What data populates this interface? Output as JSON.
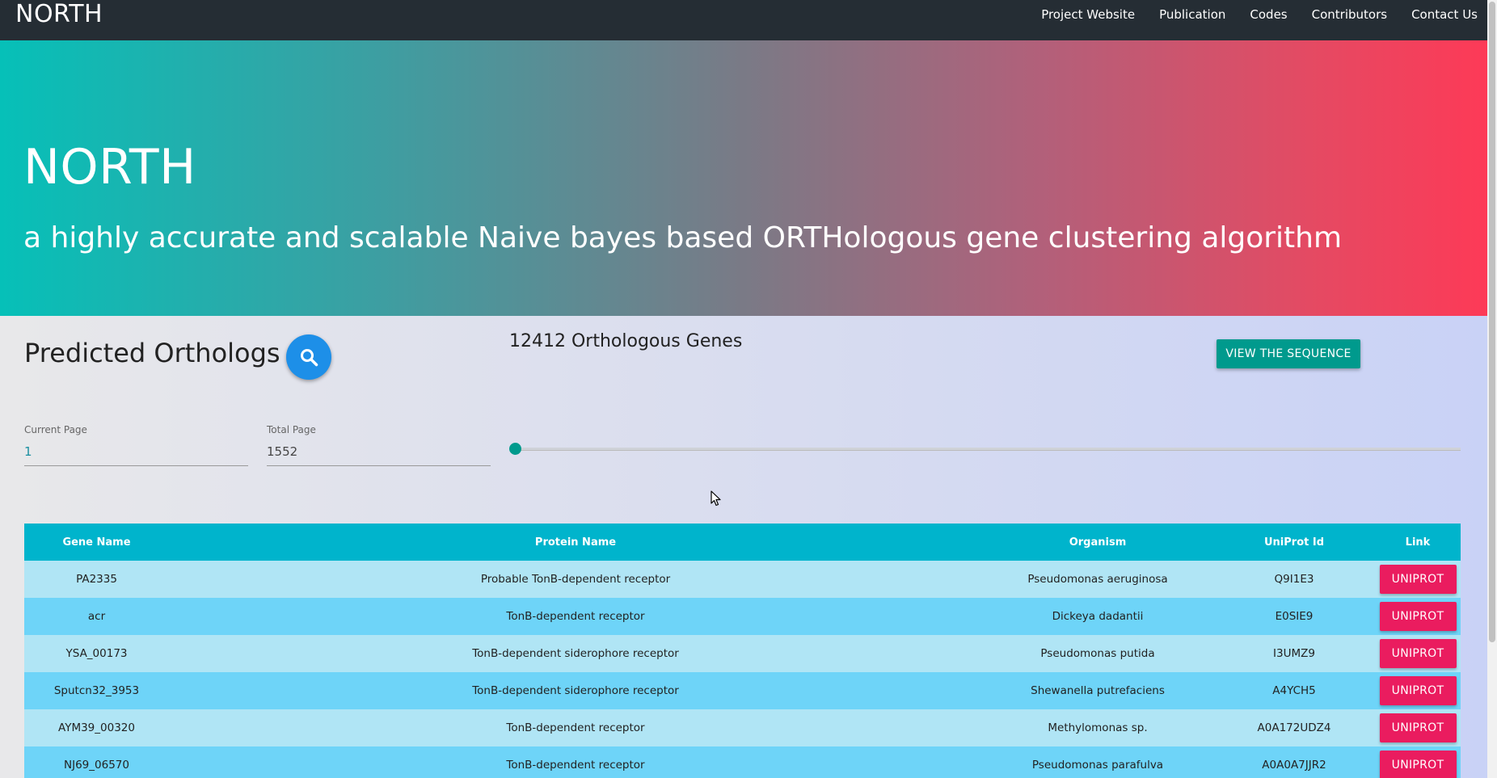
{
  "navbar": {
    "brand": "NORTH",
    "links": [
      "Project Website",
      "Publication",
      "Codes",
      "Contributors",
      "Contact Us"
    ]
  },
  "hero": {
    "title": "NORTH",
    "subtitle": "a highly accurate and scalable Naive bayes based ORTHologous gene clustering algorithm"
  },
  "section": {
    "title": "Predicted Orthologs",
    "gene_count": "12412 Orthologous Genes",
    "view_button": "VIEW THE SEQUENCE",
    "current_page_label": "Current Page",
    "current_page_value": "1",
    "total_page_label": "Total Page",
    "total_page_value": "1552",
    "slider_value": 1
  },
  "table": {
    "headers": [
      "Gene Name",
      "Protein Name",
      "Organism",
      "UniProt Id",
      "Link"
    ],
    "rows": [
      {
        "gene": "PA2335",
        "protein": "Probable TonB-dependent receptor",
        "organism": "Pseudomonas aeruginosa",
        "uniprot": "Q9I1E3",
        "link": "UNIPROT"
      },
      {
        "gene": "acr",
        "protein": "TonB-dependent receptor",
        "organism": "Dickeya dadantii",
        "uniprot": "E0SIE9",
        "link": "UNIPROT"
      },
      {
        "gene": "YSA_00173",
        "protein": "TonB-dependent siderophore receptor",
        "organism": "Pseudomonas putida",
        "uniprot": "I3UMZ9",
        "link": "UNIPROT"
      },
      {
        "gene": "Sputcn32_3953",
        "protein": "TonB-dependent siderophore receptor",
        "organism": "Shewanella putrefaciens",
        "uniprot": "A4YCH5",
        "link": "UNIPROT"
      },
      {
        "gene": "AYM39_00320",
        "protein": "TonB-dependent receptor",
        "organism": "Methylomonas sp.",
        "uniprot": "A0A172UDZ4",
        "link": "UNIPROT"
      },
      {
        "gene": "NJ69_06570",
        "protein": "TonB-dependent receptor",
        "organism": "Pseudomonas parafulva",
        "uniprot": "A0A0A7JJR2",
        "link": "UNIPROT"
      }
    ]
  },
  "colors": {
    "navbar": "#252d34",
    "accent": "#009a8d",
    "table_header": "#00b4cc",
    "uniprot_button": "#ea1c5f",
    "search_button": "#1d8fe8"
  }
}
